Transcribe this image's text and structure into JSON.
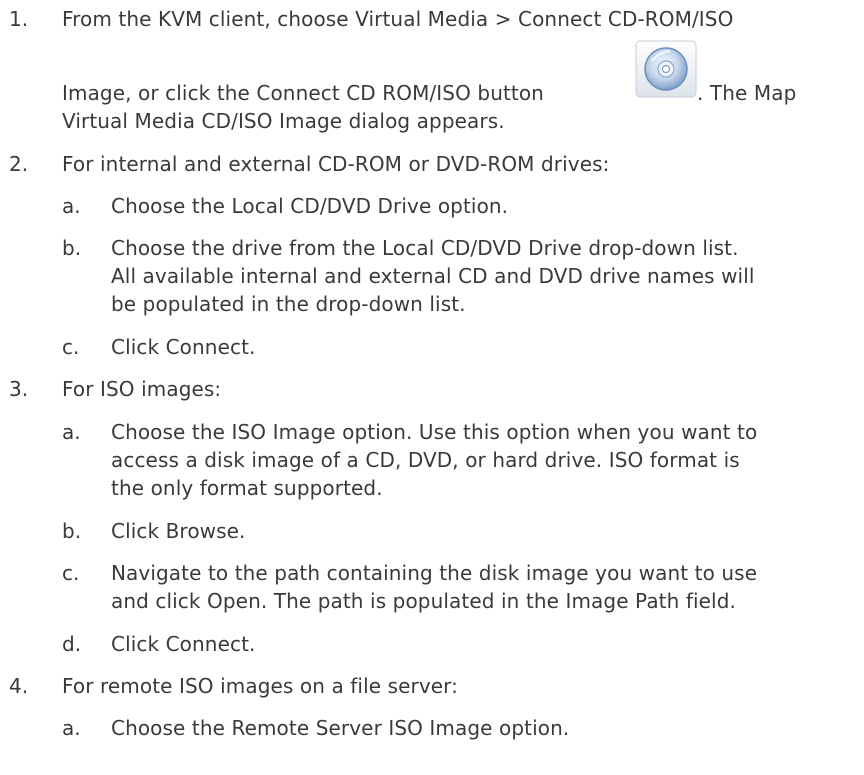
{
  "steps": [
    {
      "number": "1.",
      "lines": [
        "From the KVM client, choose Virtual Media > Connect CD-ROM/ISO",
        "Image, or click the Connect CD ROM/ISO button",
        "Virtual Media CD/ISO Image dialog appears."
      ],
      "after_icon_text": ". The Map",
      "icon": "cd-rom-icon"
    },
    {
      "number": "2.",
      "text": "For internal and external CD-ROM or DVD-ROM drives:",
      "substeps": [
        {
          "letter": "a.",
          "lines": [
            "Choose the Local CD/DVD Drive option."
          ]
        },
        {
          "letter": "b.",
          "lines": [
            "Choose the drive from the Local CD/DVD Drive drop-down list.",
            "All available internal and external CD and DVD drive names will",
            "be populated in the drop-down list."
          ]
        },
        {
          "letter": "c.",
          "lines": [
            "Click Connect."
          ]
        }
      ]
    },
    {
      "number": "3.",
      "text": "For ISO images:",
      "substeps": [
        {
          "letter": "a.",
          "lines": [
            "Choose the ISO Image option. Use this option when you want to",
            "access a disk image of a CD, DVD, or hard drive. ISO format is",
            "the only format supported."
          ]
        },
        {
          "letter": "b.",
          "lines": [
            "Click Browse."
          ]
        },
        {
          "letter": "c.",
          "lines": [
            "Navigate to the path containing the disk image you want to use",
            "and click Open. The path is populated in the Image Path field."
          ]
        },
        {
          "letter": "d.",
          "lines": [
            "Click Connect."
          ]
        }
      ]
    },
    {
      "number": "4.",
      "text": "For remote ISO images on a file server:",
      "substeps": [
        {
          "letter": "a.",
          "lines": [
            "Choose the Remote Server ISO Image option."
          ]
        }
      ]
    }
  ]
}
